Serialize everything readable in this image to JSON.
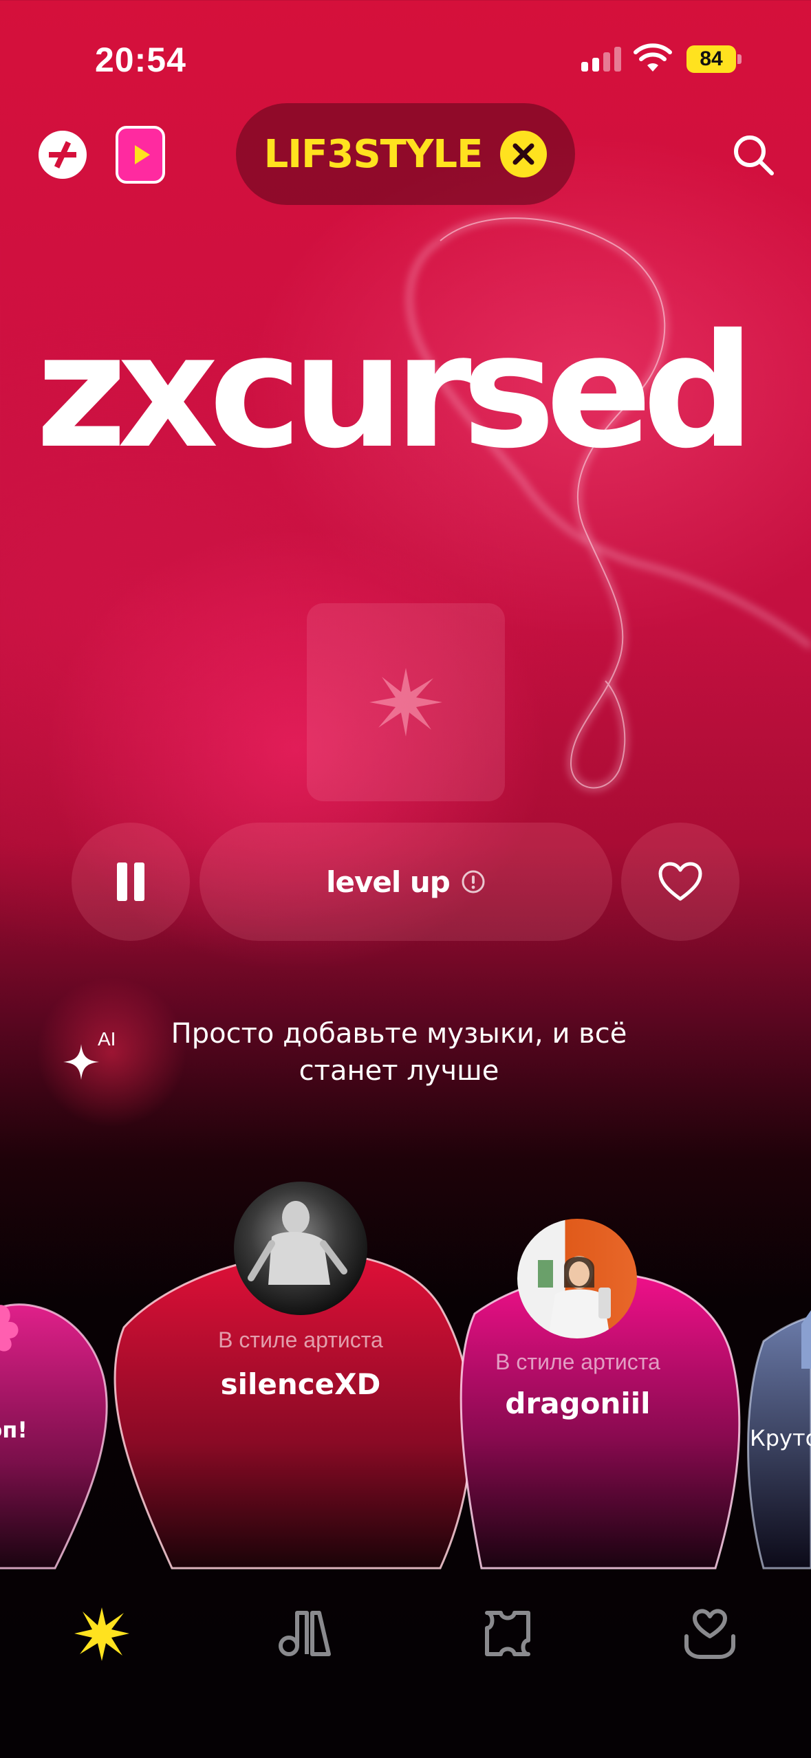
{
  "status_bar": {
    "time": "20:54",
    "battery": "84"
  },
  "top_bar": {
    "vibe_name": "LIF3STYLE",
    "plus_icon": "plus-slash-icon",
    "play_icon": "play-icon",
    "search_icon": "search-icon",
    "close_icon": "close-icon"
  },
  "hero": {
    "artist": "zxcursed"
  },
  "player": {
    "track": "level up",
    "pause_icon": "pause-icon",
    "like_icon": "heart-icon",
    "info_icon": "info-icon"
  },
  "ai_hint": {
    "badge": "AI",
    "text": "Просто добавьте музыки, и всё станет лучше"
  },
  "cards": [
    {
      "title": "оп!",
      "subtitle": ""
    },
    {
      "subtitle": "В стиле артиста",
      "title": "silenceXD"
    },
    {
      "subtitle": "В стиле артиста",
      "title": "dragoniil"
    },
    {
      "title": "Круто",
      "subtitle": ""
    }
  ],
  "tabs": [
    {
      "icon": "vibe-star-icon",
      "active": true
    },
    {
      "icon": "collection-icon",
      "active": false
    },
    {
      "icon": "map-icon",
      "active": false
    },
    {
      "icon": "heart-hand-icon",
      "active": false
    }
  ],
  "colors": {
    "accent": "#ffe21f",
    "background_top": "#d5103b",
    "background_bottom": "#050104",
    "pink": "#ff2aa0"
  }
}
